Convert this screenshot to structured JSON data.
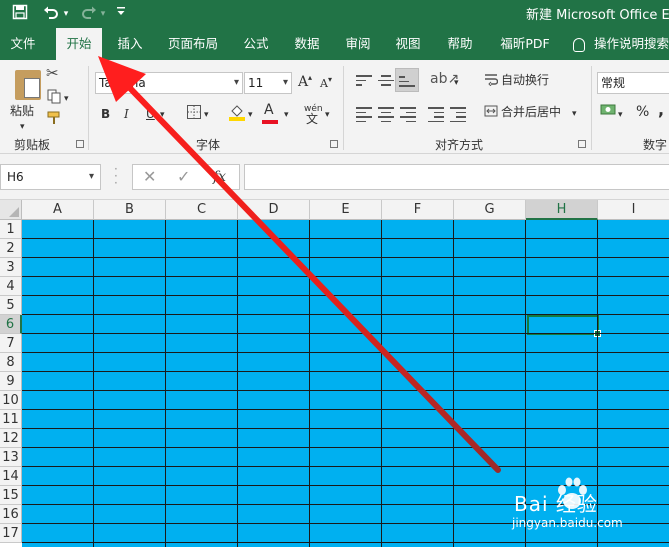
{
  "window": {
    "title": "新建 Microsoft Office Exc",
    "accent_color": "#217346"
  },
  "qat": {
    "save_icon": "save-icon",
    "undo_icon": "undo-icon",
    "redo_icon": "redo-icon",
    "customize_icon": "chevron-down-icon"
  },
  "tabs": [
    {
      "label": "文件",
      "active": false
    },
    {
      "label": "开始",
      "active": true
    },
    {
      "label": "插入",
      "active": false
    },
    {
      "label": "页面布局",
      "active": false
    },
    {
      "label": "公式",
      "active": false
    },
    {
      "label": "数据",
      "active": false
    },
    {
      "label": "审阅",
      "active": false
    },
    {
      "label": "视图",
      "active": false
    },
    {
      "label": "帮助",
      "active": false
    },
    {
      "label": "福昕PDF",
      "active": false
    }
  ],
  "tell_me": "操作说明搜索",
  "ribbon": {
    "clipboard": {
      "paste_label": "粘贴",
      "group_label": "剪贴板"
    },
    "font": {
      "font_name": "Tahoma",
      "font_size": "11",
      "bold": "B",
      "italic": "I",
      "underline": "U",
      "grow_font": "A",
      "shrink_font": "A",
      "font_color_label": "A",
      "phonetic_label": "wén",
      "group_label": "字体",
      "font_color": "#e81123",
      "fill_color": "#ffd700"
    },
    "alignment": {
      "wrap_text": "自动换行",
      "merge_center": "合并后居中",
      "group_label": "对齐方式"
    },
    "number": {
      "format": "常规",
      "percent": "%",
      "comma": ",",
      "group_label": "数字"
    }
  },
  "formula_bar": {
    "name_box": "H6",
    "cancel": "✕",
    "enter": "✓",
    "fx": "fx",
    "value": ""
  },
  "sheet": {
    "columns": [
      "A",
      "B",
      "C",
      "D",
      "E",
      "F",
      "G",
      "H",
      "I"
    ],
    "rows": [
      "1",
      "2",
      "3",
      "4",
      "5",
      "6",
      "7",
      "8",
      "9",
      "10",
      "11",
      "12",
      "13",
      "14",
      "15",
      "16",
      "17"
    ],
    "selected_column": "H",
    "selected_row": "6",
    "fill_color": "#00b0f0",
    "border_color": "#1a1a1a"
  },
  "annotation": {
    "arrow_color": "#e8211b"
  },
  "watermark": {
    "line1": "Bai 经验",
    "line2": "jingyan.baidu.com"
  }
}
